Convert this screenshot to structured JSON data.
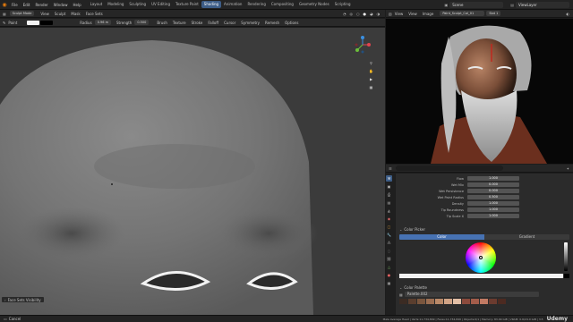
{
  "topbar": {
    "menus": [
      "File",
      "Edit",
      "Render",
      "Window",
      "Help"
    ],
    "workspaces": [
      "Layout",
      "Modeling",
      "Sculpting",
      "UV Editing",
      "Texture Paint",
      "Shading",
      "Animation",
      "Rendering",
      "Compositing",
      "Geometry Nodes",
      "Scripting"
    ],
    "active_workspace": "Shading",
    "scene": "Scene",
    "view_layer": "ViewLayer"
  },
  "viewport_header": {
    "mode": "Sculpt Mode",
    "menus": [
      "View",
      "Sculpt",
      "Mask",
      "Face Sets"
    ]
  },
  "tool_settings": {
    "brush": "Paint",
    "radius_label": "Radius",
    "radius_value": "0.96 m",
    "strength_label": "Strength",
    "strength_value": "0.500",
    "items": [
      "Brush",
      "Texture",
      "Stroke",
      "Falloff",
      "Cursor",
      "Symmetry",
      "Remesh",
      "Options"
    ]
  },
  "viewport": {
    "overlay_label": "Face Sets Visibility"
  },
  "render_header": {
    "menus": [
      "View",
      "View",
      "Image"
    ],
    "image_name": "Slot 1",
    "render_name": "Paint_Sculpt_Col_01"
  },
  "properties": {
    "rows": [
      {
        "label": "Flow",
        "value": "1.000"
      },
      {
        "label": "Wet Mix",
        "value": "0.000"
      },
      {
        "label": "Wet Persistence",
        "value": "0.000"
      },
      {
        "label": "Wet Paint Radius",
        "value": "0.500"
      },
      {
        "label": "Density",
        "value": "1.000"
      },
      {
        "label": "Tip Roundness",
        "value": "1.000"
      },
      {
        "label": "Tip Scale X",
        "value": "1.000"
      }
    ],
    "color_picker_title": "Color Picker",
    "color_tab": "Color",
    "gradient_tab": "Gradient",
    "color_palette_title": "Color Palette",
    "palette_name": "Palette.002",
    "palette_swatches": [
      "#3b2b23",
      "#5a3e2e",
      "#7a563e",
      "#9b6e52",
      "#b98968",
      "#d1a486",
      "#e3bfa6",
      "#8b4a3c",
      "#a35c4a",
      "#c27a63",
      "#6b3b2f",
      "#4c2a21"
    ]
  },
  "status": {
    "left": "Cancel",
    "right": "Male Average Head | Verts:11,734,849 | Faces:11,734,840 | Objects:0/1 | Memory: 83.09 GiB | VRAM: 0.6/24.0 GiB | 3.5",
    "brand": "Udemy"
  }
}
